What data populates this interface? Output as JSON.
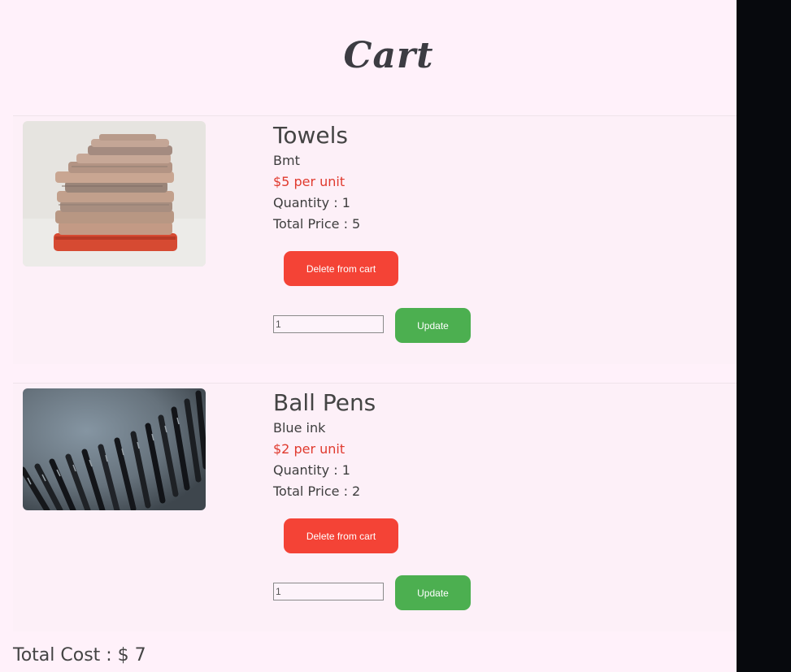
{
  "page": {
    "title": "Cart"
  },
  "cart": {
    "items": [
      {
        "name": "Towels",
        "description": "Bmt",
        "price_text": "$5 per unit",
        "quantity_text": "Quantity : 1",
        "total_text": "Total Price : 5",
        "delete_label": "Delete from cart",
        "qty_value": "1",
        "update_label": "Update",
        "image_icon": "towel-stack-photo"
      },
      {
        "name": "Ball Pens",
        "description": "Blue ink",
        "price_text": "$2 per unit",
        "quantity_text": "Quantity : 1",
        "total_text": "Total Price : 2",
        "delete_label": "Delete from cart",
        "qty_value": "1",
        "update_label": "Update",
        "image_icon": "ball-pens-photo"
      }
    ]
  },
  "summary": {
    "total_label": "Total Cost : $ 7"
  },
  "colors": {
    "page_bg": "#fff1fa",
    "delete_button": "#f44336",
    "update_button": "#4caf50",
    "price_text": "#e03a2e",
    "side_panel": "#07090d"
  }
}
